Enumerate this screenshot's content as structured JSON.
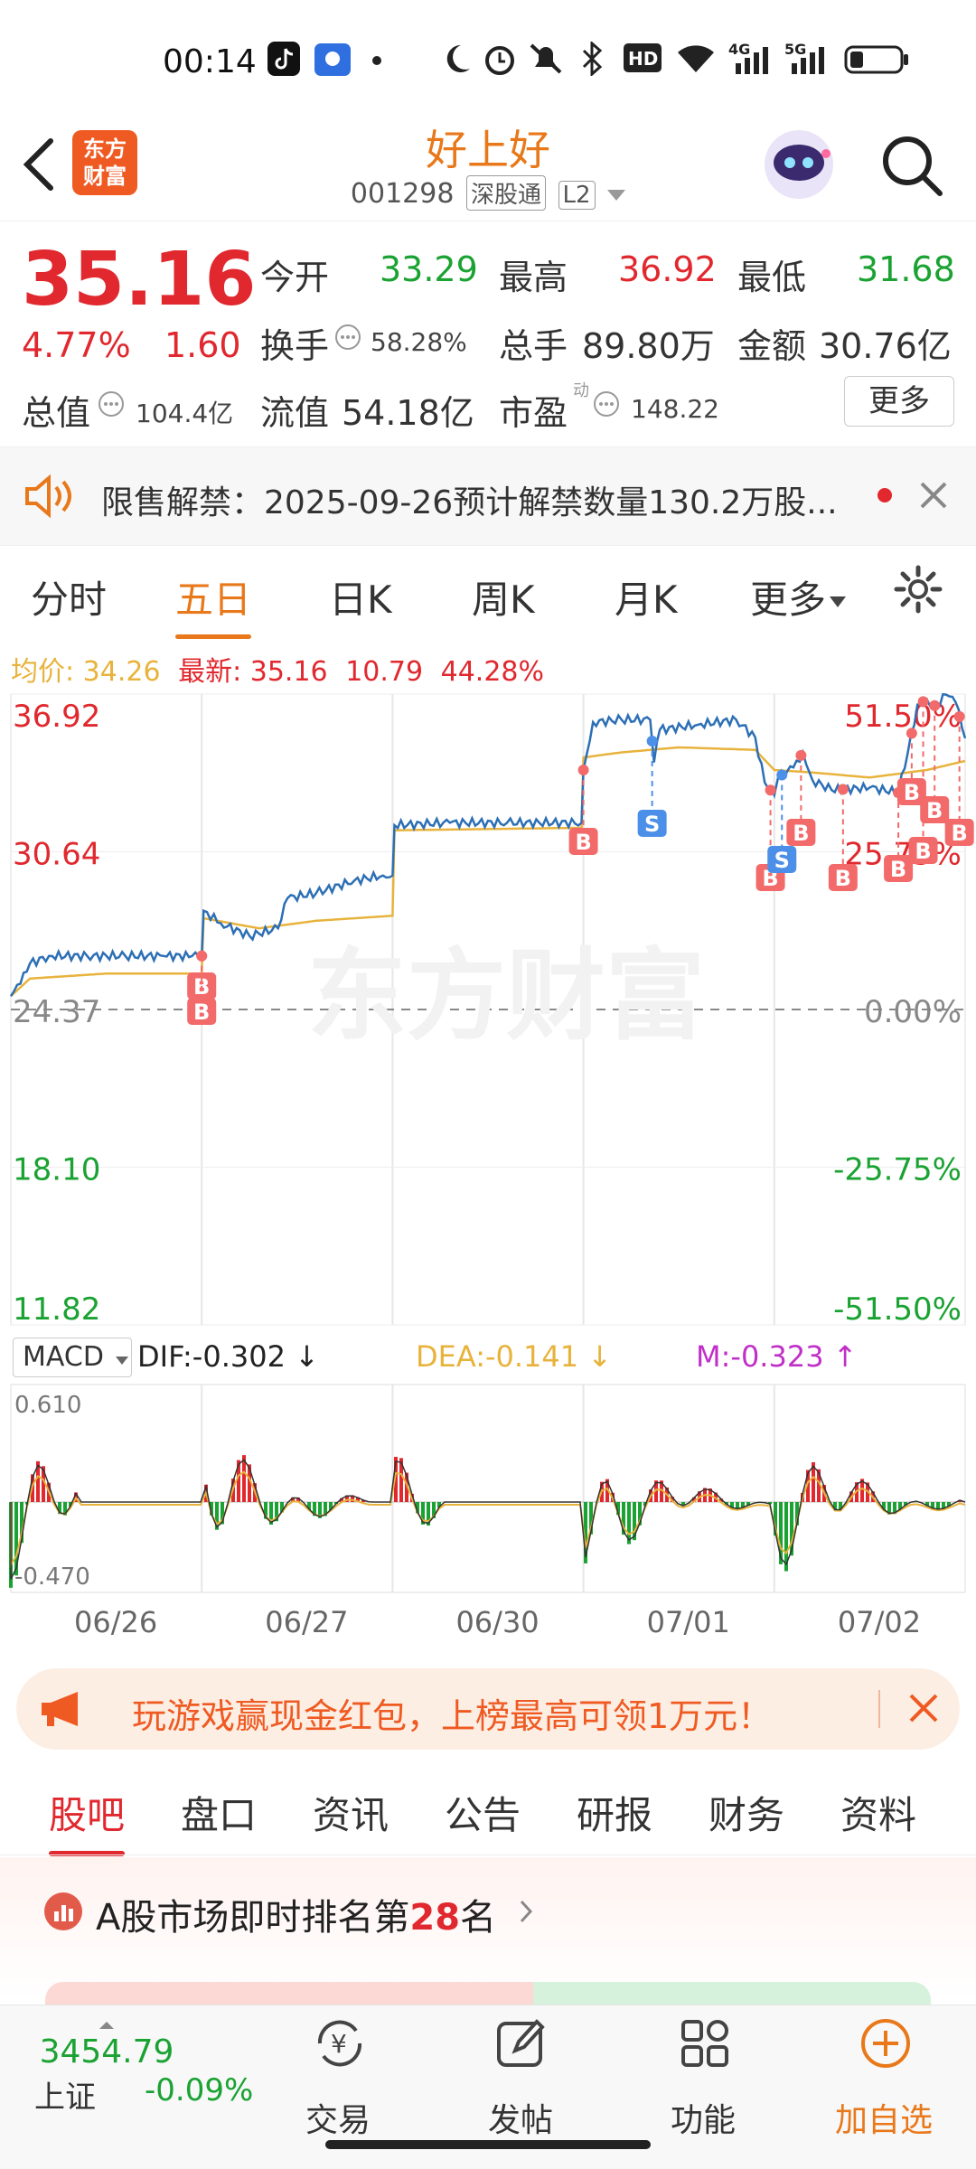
{
  "status": {
    "time": "00:14",
    "icons": [
      "tiktok-icon",
      "baidu-icon",
      "dot-icon",
      "moon-icon",
      "alarm-icon",
      "mute-icon",
      "bluetooth-icon",
      "hd-icon",
      "wifi-icon",
      "signal-4g-icon",
      "signal-5g-icon",
      "battery-icon"
    ]
  },
  "header": {
    "logo_line1": "东方",
    "logo_line2": "财富",
    "stock_name": "好上好",
    "stock_code": "001298",
    "tag_connect": "深股通",
    "tag_level": "L2"
  },
  "quote": {
    "price": "35.16",
    "change_pct": "4.77%",
    "change": "1.60",
    "open_label": "今开",
    "open": "33.29",
    "high_label": "最高",
    "high": "36.92",
    "low_label": "最低",
    "low": "31.68",
    "turnover_label": "换手",
    "turnover": "58.28%",
    "volume_label": "总手",
    "volume": "89.80万",
    "amount_label": "金额",
    "amount": "30.76亿",
    "mktcap_label": "总值",
    "mktcap": "104.4亿",
    "float_label": "流值",
    "float": "54.18亿",
    "pe_label": "市盈",
    "pe_sup": "动",
    "pe": "148.22",
    "more": "更多"
  },
  "notice": {
    "text": "限售解禁：2025-09-26预计解禁数量130.2万股..."
  },
  "chart_tabs": [
    "分时",
    "五日",
    "日K",
    "周K",
    "月K",
    "更多"
  ],
  "chart_tabs_active": 1,
  "avg_line": {
    "avg_label": "均价:",
    "avg": "34.26",
    "last_label": "最新:",
    "last": "35.16",
    "vol": "10.79",
    "pct": "44.28%"
  },
  "watermark": "东方财富",
  "chart_data": {
    "type": "line",
    "title": "",
    "x_day_labels": [
      "06/26",
      "06/27",
      "06/30",
      "07/01",
      "07/02"
    ],
    "y_ticks_left": [
      "36.92",
      "30.64",
      "24.37",
      "18.10",
      "11.82"
    ],
    "y_ticks_right": [
      "51.50%",
      "25.75%",
      "0.00%",
      "-25.75%",
      "-51.50%"
    ],
    "ylim": [
      11.82,
      36.92
    ],
    "prev_close": 24.37,
    "series": [
      {
        "color": "#2c6fb5",
        "x": [
          0,
          0.05,
          0.1,
          0.2,
          0.4,
          0.6,
          0.8,
          0.95,
          1.0,
          1.01,
          1.1,
          1.25,
          1.4,
          1.45,
          1.6,
          1.8,
          1.95,
          2.0,
          2.01,
          2.3,
          2.6,
          2.99,
          3.0,
          3.05,
          3.2,
          3.35,
          3.37,
          3.4,
          3.6,
          3.8,
          3.9,
          3.95,
          4.0,
          4.02,
          4.1,
          4.15,
          4.2,
          4.3,
          4.5,
          4.65,
          4.7,
          4.75,
          4.8,
          4.85,
          4.9,
          4.95,
          5.0
        ],
        "values": [
          24.9,
          25.4,
          26.2,
          26.5,
          26.5,
          26.5,
          26.5,
          26.5,
          26.5,
          28.3,
          27.8,
          27.3,
          27.6,
          28.8,
          29.0,
          29.5,
          29.7,
          29.7,
          31.7,
          31.8,
          31.8,
          31.8,
          33.9,
          35.8,
          35.9,
          35.9,
          34.2,
          35.5,
          35.7,
          35.9,
          35.2,
          33.4,
          32.9,
          33.6,
          34.0,
          34.6,
          33.5,
          33.1,
          33.2,
          33.0,
          34.6,
          36.5,
          36.7,
          36.4,
          36.9,
          36.6,
          35.16
        ]
      },
      {
        "color": "#e8b33c",
        "x": [
          0,
          0.1,
          0.5,
          1.0,
          1.01,
          1.3,
          1.6,
          2.0,
          2.01,
          2.99,
          3.0,
          3.2,
          3.5,
          3.9,
          4.0,
          4.2,
          4.5,
          4.8,
          5.0
        ],
        "values": [
          24.9,
          25.6,
          25.8,
          25.8,
          28.0,
          27.6,
          27.9,
          28.1,
          31.5,
          31.6,
          34.4,
          34.6,
          34.8,
          34.7,
          33.9,
          33.8,
          33.6,
          33.9,
          34.26
        ]
      }
    ],
    "trade_marks": [
      {
        "day_x": 1.0,
        "label": "B",
        "kind": "buy"
      },
      {
        "day_x": 1.0,
        "label": "B",
        "kind": "buy"
      },
      {
        "day_x": 3.0,
        "label": "B",
        "kind": "buy"
      },
      {
        "day_x": 3.36,
        "label": "S",
        "kind": "sell"
      },
      {
        "day_x": 3.98,
        "label": "B",
        "kind": "buy"
      },
      {
        "day_x": 4.04,
        "label": "S",
        "kind": "sell"
      },
      {
        "day_x": 4.14,
        "label": "B",
        "kind": "buy"
      },
      {
        "day_x": 4.36,
        "label": "B",
        "kind": "buy"
      },
      {
        "day_x": 4.65,
        "label": "B",
        "kind": "buy"
      },
      {
        "day_x": 4.72,
        "label": "B",
        "kind": "buy"
      },
      {
        "day_x": 4.78,
        "label": "B",
        "kind": "buy"
      },
      {
        "day_x": 4.84,
        "label": "B",
        "kind": "buy"
      },
      {
        "day_x": 4.97,
        "label": "B",
        "kind": "buy"
      }
    ]
  },
  "macd": {
    "label": "MACD",
    "dif": "DIF:-0.302",
    "dea": "DEA:-0.141",
    "m": "M:-0.323",
    "top": "0.610",
    "bottom": "-0.470",
    "dif_arrow": "↓",
    "dea_arrow": "↓",
    "m_arrow": "↑"
  },
  "banner": {
    "text": "玩游戏赢现金红包，上榜最高可领1万元！"
  },
  "bottom_tabs": [
    "股吧",
    "盘口",
    "资讯",
    "公告",
    "研报",
    "财务",
    "资料"
  ],
  "bottom_tabs_active": 0,
  "rank": {
    "prefix": "A股市场即时排名第",
    "num": "28",
    "suffix": "名"
  },
  "bottom_nav": {
    "index_value": "3454.79",
    "index_name": "上证",
    "index_change": "-0.09%",
    "trade": "交易",
    "post": "发帖",
    "func": "功能",
    "add": "加自选"
  },
  "colors": {
    "up": "#e0282e",
    "down": "#1aa232",
    "accent": "#e8781a",
    "price_line": "#2c6fb5",
    "avg_line": "#e8b33c"
  }
}
